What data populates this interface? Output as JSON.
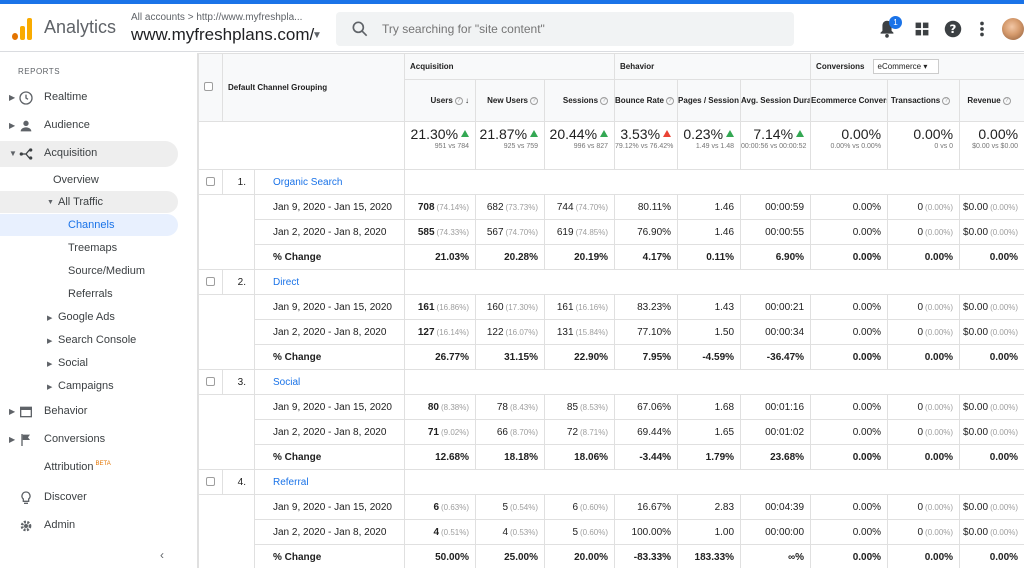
{
  "header": {
    "app_name": "Analytics",
    "account_path": "All accounts > http://www.myfreshpla...",
    "account_name": "www.myfreshplans.com/",
    "search_placeholder": "Try searching for \"site content\"",
    "notification_count": "1"
  },
  "sidebar": {
    "heading": "REPORTS",
    "items": [
      {
        "label": "Realtime"
      },
      {
        "label": "Audience"
      },
      {
        "label": "Acquisition"
      },
      {
        "label": "Behavior"
      },
      {
        "label": "Conversions"
      },
      {
        "label": "Attribution",
        "badge": "BETA"
      },
      {
        "label": "Discover"
      },
      {
        "label": "Admin"
      }
    ],
    "acquisition": {
      "overview": "Overview",
      "all_traffic": "All Traffic",
      "channels": "Channels",
      "treemaps": "Treemaps",
      "source_medium": "Source/Medium",
      "referrals": "Referrals",
      "google_ads": "Google Ads",
      "search_console": "Search Console",
      "social": "Social",
      "campaigns": "Campaigns"
    }
  },
  "table": {
    "dimension_header": "Default Channel Grouping",
    "groups": {
      "acquisition": "Acquisition",
      "behavior": "Behavior",
      "conversions": "Conversions",
      "conversions_select": "eCommerce"
    },
    "columns": [
      "Users",
      "New Users",
      "Sessions",
      "Bounce Rate",
      "Pages / Session",
      "Avg. Session Duration",
      "Ecommerce Conversion Rate",
      "Transactions",
      "Revenue"
    ],
    "summary": [
      {
        "value": "21.30%",
        "detail": "951 vs 784",
        "trend": "up"
      },
      {
        "value": "21.87%",
        "detail": "925 vs 759",
        "trend": "up"
      },
      {
        "value": "20.44%",
        "detail": "996 vs 827",
        "trend": "up"
      },
      {
        "value": "3.53%",
        "detail": "79.12% vs 76.42%",
        "trend": "red"
      },
      {
        "value": "0.23%",
        "detail": "1.49 vs 1.48",
        "trend": "up"
      },
      {
        "value": "7.14%",
        "detail": "00:00:56 vs 00:00:52",
        "trend": "up"
      },
      {
        "value": "0.00%",
        "detail": "0.00% vs 0.00%",
        "trend": ""
      },
      {
        "value": "0.00%",
        "detail": "0 vs 0",
        "trend": ""
      },
      {
        "value": "0.00%",
        "detail": "$0.00 vs $0.00",
        "trend": ""
      }
    ],
    "rows": [
      {
        "index": "1.",
        "name": "Organic Search",
        "periods": [
          {
            "range": "Jan 9, 2020 - Jan 15, 2020",
            "users": "708",
            "users_pct": "(74.14%)",
            "new_users": "682",
            "new_users_pct": "(73.73%)",
            "sessions": "744",
            "sessions_pct": "(74.70%)",
            "bounce": "80.11%",
            "pages": "1.46",
            "duration": "00:00:59",
            "conv": "0.00%",
            "trans": "0",
            "trans_pct": "(0.00%)",
            "rev": "$0.00",
            "rev_pct": "(0.00%)"
          },
          {
            "range": "Jan 2, 2020 - Jan 8, 2020",
            "users": "585",
            "users_pct": "(74.33%)",
            "new_users": "567",
            "new_users_pct": "(74.70%)",
            "sessions": "619",
            "sessions_pct": "(74.85%)",
            "bounce": "76.90%",
            "pages": "1.46",
            "duration": "00:00:55",
            "conv": "0.00%",
            "trans": "0",
            "trans_pct": "(0.00%)",
            "rev": "$0.00",
            "rev_pct": "(0.00%)"
          }
        ],
        "change": {
          "label": "% Change",
          "values": [
            "21.03%",
            "20.28%",
            "20.19%",
            "4.17%",
            "0.11%",
            "6.90%",
            "0.00%",
            "0.00%",
            "0.00%"
          ]
        }
      },
      {
        "index": "2.",
        "name": "Direct",
        "periods": [
          {
            "range": "Jan 9, 2020 - Jan 15, 2020",
            "users": "161",
            "users_pct": "(16.86%)",
            "new_users": "160",
            "new_users_pct": "(17.30%)",
            "sessions": "161",
            "sessions_pct": "(16.16%)",
            "bounce": "83.23%",
            "pages": "1.43",
            "duration": "00:00:21",
            "conv": "0.00%",
            "trans": "0",
            "trans_pct": "(0.00%)",
            "rev": "$0.00",
            "rev_pct": "(0.00%)"
          },
          {
            "range": "Jan 2, 2020 - Jan 8, 2020",
            "users": "127",
            "users_pct": "(16.14%)",
            "new_users": "122",
            "new_users_pct": "(16.07%)",
            "sessions": "131",
            "sessions_pct": "(15.84%)",
            "bounce": "77.10%",
            "pages": "1.50",
            "duration": "00:00:34",
            "conv": "0.00%",
            "trans": "0",
            "trans_pct": "(0.00%)",
            "rev": "$0.00",
            "rev_pct": "(0.00%)"
          }
        ],
        "change": {
          "label": "% Change",
          "values": [
            "26.77%",
            "31.15%",
            "22.90%",
            "7.95%",
            "-4.59%",
            "-36.47%",
            "0.00%",
            "0.00%",
            "0.00%"
          ]
        }
      },
      {
        "index": "3.",
        "name": "Social",
        "periods": [
          {
            "range": "Jan 9, 2020 - Jan 15, 2020",
            "users": "80",
            "users_pct": "(8.38%)",
            "new_users": "78",
            "new_users_pct": "(8.43%)",
            "sessions": "85",
            "sessions_pct": "(8.53%)",
            "bounce": "67.06%",
            "pages": "1.68",
            "duration": "00:01:16",
            "conv": "0.00%",
            "trans": "0",
            "trans_pct": "(0.00%)",
            "rev": "$0.00",
            "rev_pct": "(0.00%)"
          },
          {
            "range": "Jan 2, 2020 - Jan 8, 2020",
            "users": "71",
            "users_pct": "(9.02%)",
            "new_users": "66",
            "new_users_pct": "(8.70%)",
            "sessions": "72",
            "sessions_pct": "(8.71%)",
            "bounce": "69.44%",
            "pages": "1.65",
            "duration": "00:01:02",
            "conv": "0.00%",
            "trans": "0",
            "trans_pct": "(0.00%)",
            "rev": "$0.00",
            "rev_pct": "(0.00%)"
          }
        ],
        "change": {
          "label": "% Change",
          "values": [
            "12.68%",
            "18.18%",
            "18.06%",
            "-3.44%",
            "1.79%",
            "23.68%",
            "0.00%",
            "0.00%",
            "0.00%"
          ]
        }
      },
      {
        "index": "4.",
        "name": "Referral",
        "periods": [
          {
            "range": "Jan 9, 2020 - Jan 15, 2020",
            "users": "6",
            "users_pct": "(0.63%)",
            "new_users": "5",
            "new_users_pct": "(0.54%)",
            "sessions": "6",
            "sessions_pct": "(0.60%)",
            "bounce": "16.67%",
            "pages": "2.83",
            "duration": "00:04:39",
            "conv": "0.00%",
            "trans": "0",
            "trans_pct": "(0.00%)",
            "rev": "$0.00",
            "rev_pct": "(0.00%)"
          },
          {
            "range": "Jan 2, 2020 - Jan 8, 2020",
            "users": "4",
            "users_pct": "(0.51%)",
            "new_users": "4",
            "new_users_pct": "(0.53%)",
            "sessions": "5",
            "sessions_pct": "(0.60%)",
            "bounce": "100.00%",
            "pages": "1.00",
            "duration": "00:00:00",
            "conv": "0.00%",
            "trans": "0",
            "trans_pct": "(0.00%)",
            "rev": "$0.00",
            "rev_pct": "(0.00%)"
          }
        ],
        "change": {
          "label": "% Change",
          "values": [
            "50.00%",
            "25.00%",
            "20.00%",
            "-83.33%",
            "183.33%",
            "∞%",
            "0.00%",
            "0.00%",
            "0.00%"
          ]
        }
      }
    ]
  },
  "colors": {
    "accent": "#1a73e8",
    "up": "#34a853",
    "down": "#ea4335",
    "logo": "#f9ab00"
  },
  "icons": [
    "search-icon",
    "bell-icon",
    "apps-grid-icon",
    "help-icon",
    "more-vert-icon",
    "clock-icon",
    "person-icon",
    "acquisition-icon",
    "behavior-icon",
    "flag-icon",
    "lightbulb-icon",
    "gear-icon"
  ]
}
